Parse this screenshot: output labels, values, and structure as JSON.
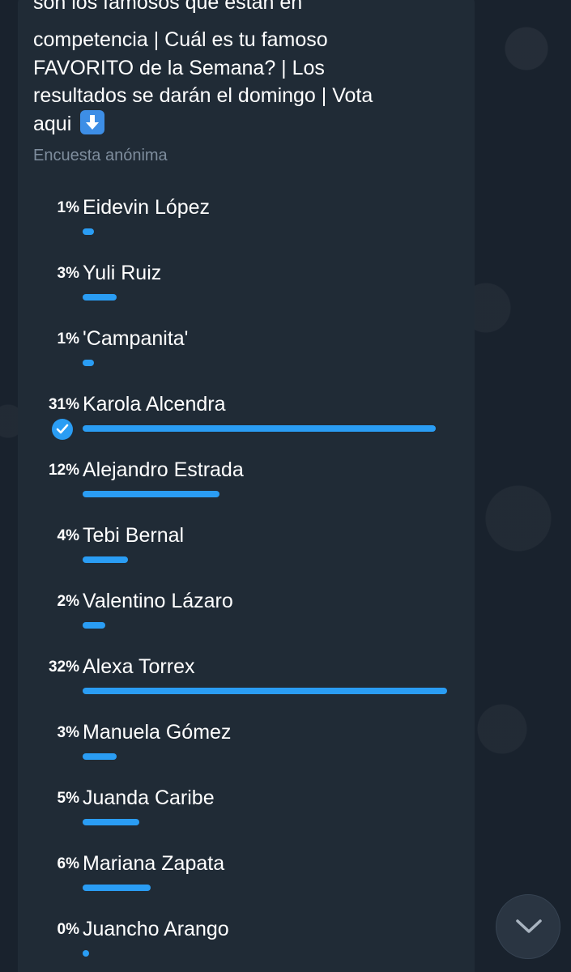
{
  "poll": {
    "question_cut_line": "son los famosos que están en",
    "question_lines": [
      "competencia | Cuál es tu famoso",
      "FAVORITO de la Semana? | Los",
      "resultados se darán el domingo | Vota"
    ],
    "question_last_line": "aqui",
    "type_label": "Encuesta anónima",
    "options": [
      {
        "percent": "1%",
        "label": "Eidevin López",
        "value": 1
      },
      {
        "percent": "3%",
        "label": "Yuli Ruiz",
        "value": 3
      },
      {
        "percent": "1%",
        "label": "'Campanita'",
        "value": 1
      },
      {
        "percent": "31%",
        "label": "Karola Alcendra",
        "value": 31,
        "selected": true
      },
      {
        "percent": "12%",
        "label": "Alejandro Estrada",
        "value": 12
      },
      {
        "percent": "4%",
        "label": "Tebi Bernal",
        "value": 4
      },
      {
        "percent": "2%",
        "label": "Valentino Lázaro",
        "value": 2
      },
      {
        "percent": "32%",
        "label": "Alexa Torrex",
        "value": 32
      },
      {
        "percent": "3%",
        "label": "Manuela Gómez",
        "value": 3
      },
      {
        "percent": "5%",
        "label": "Juanda Caribe",
        "value": 5
      },
      {
        "percent": "6%",
        "label": "Mariana Zapata",
        "value": 6
      },
      {
        "percent": "0%",
        "label": "Juancho Arango",
        "value": 0
      }
    ]
  },
  "colors": {
    "accent": "#2a9df4",
    "bubble": "#202b36",
    "background": "#19222d",
    "muted_text": "#7e8d9d"
  },
  "icons": {
    "arrow_emoji": "down-arrow-emoji-icon",
    "selected_check": "checkmark-circle-icon",
    "scroll_down": "chevron-down-icon"
  }
}
